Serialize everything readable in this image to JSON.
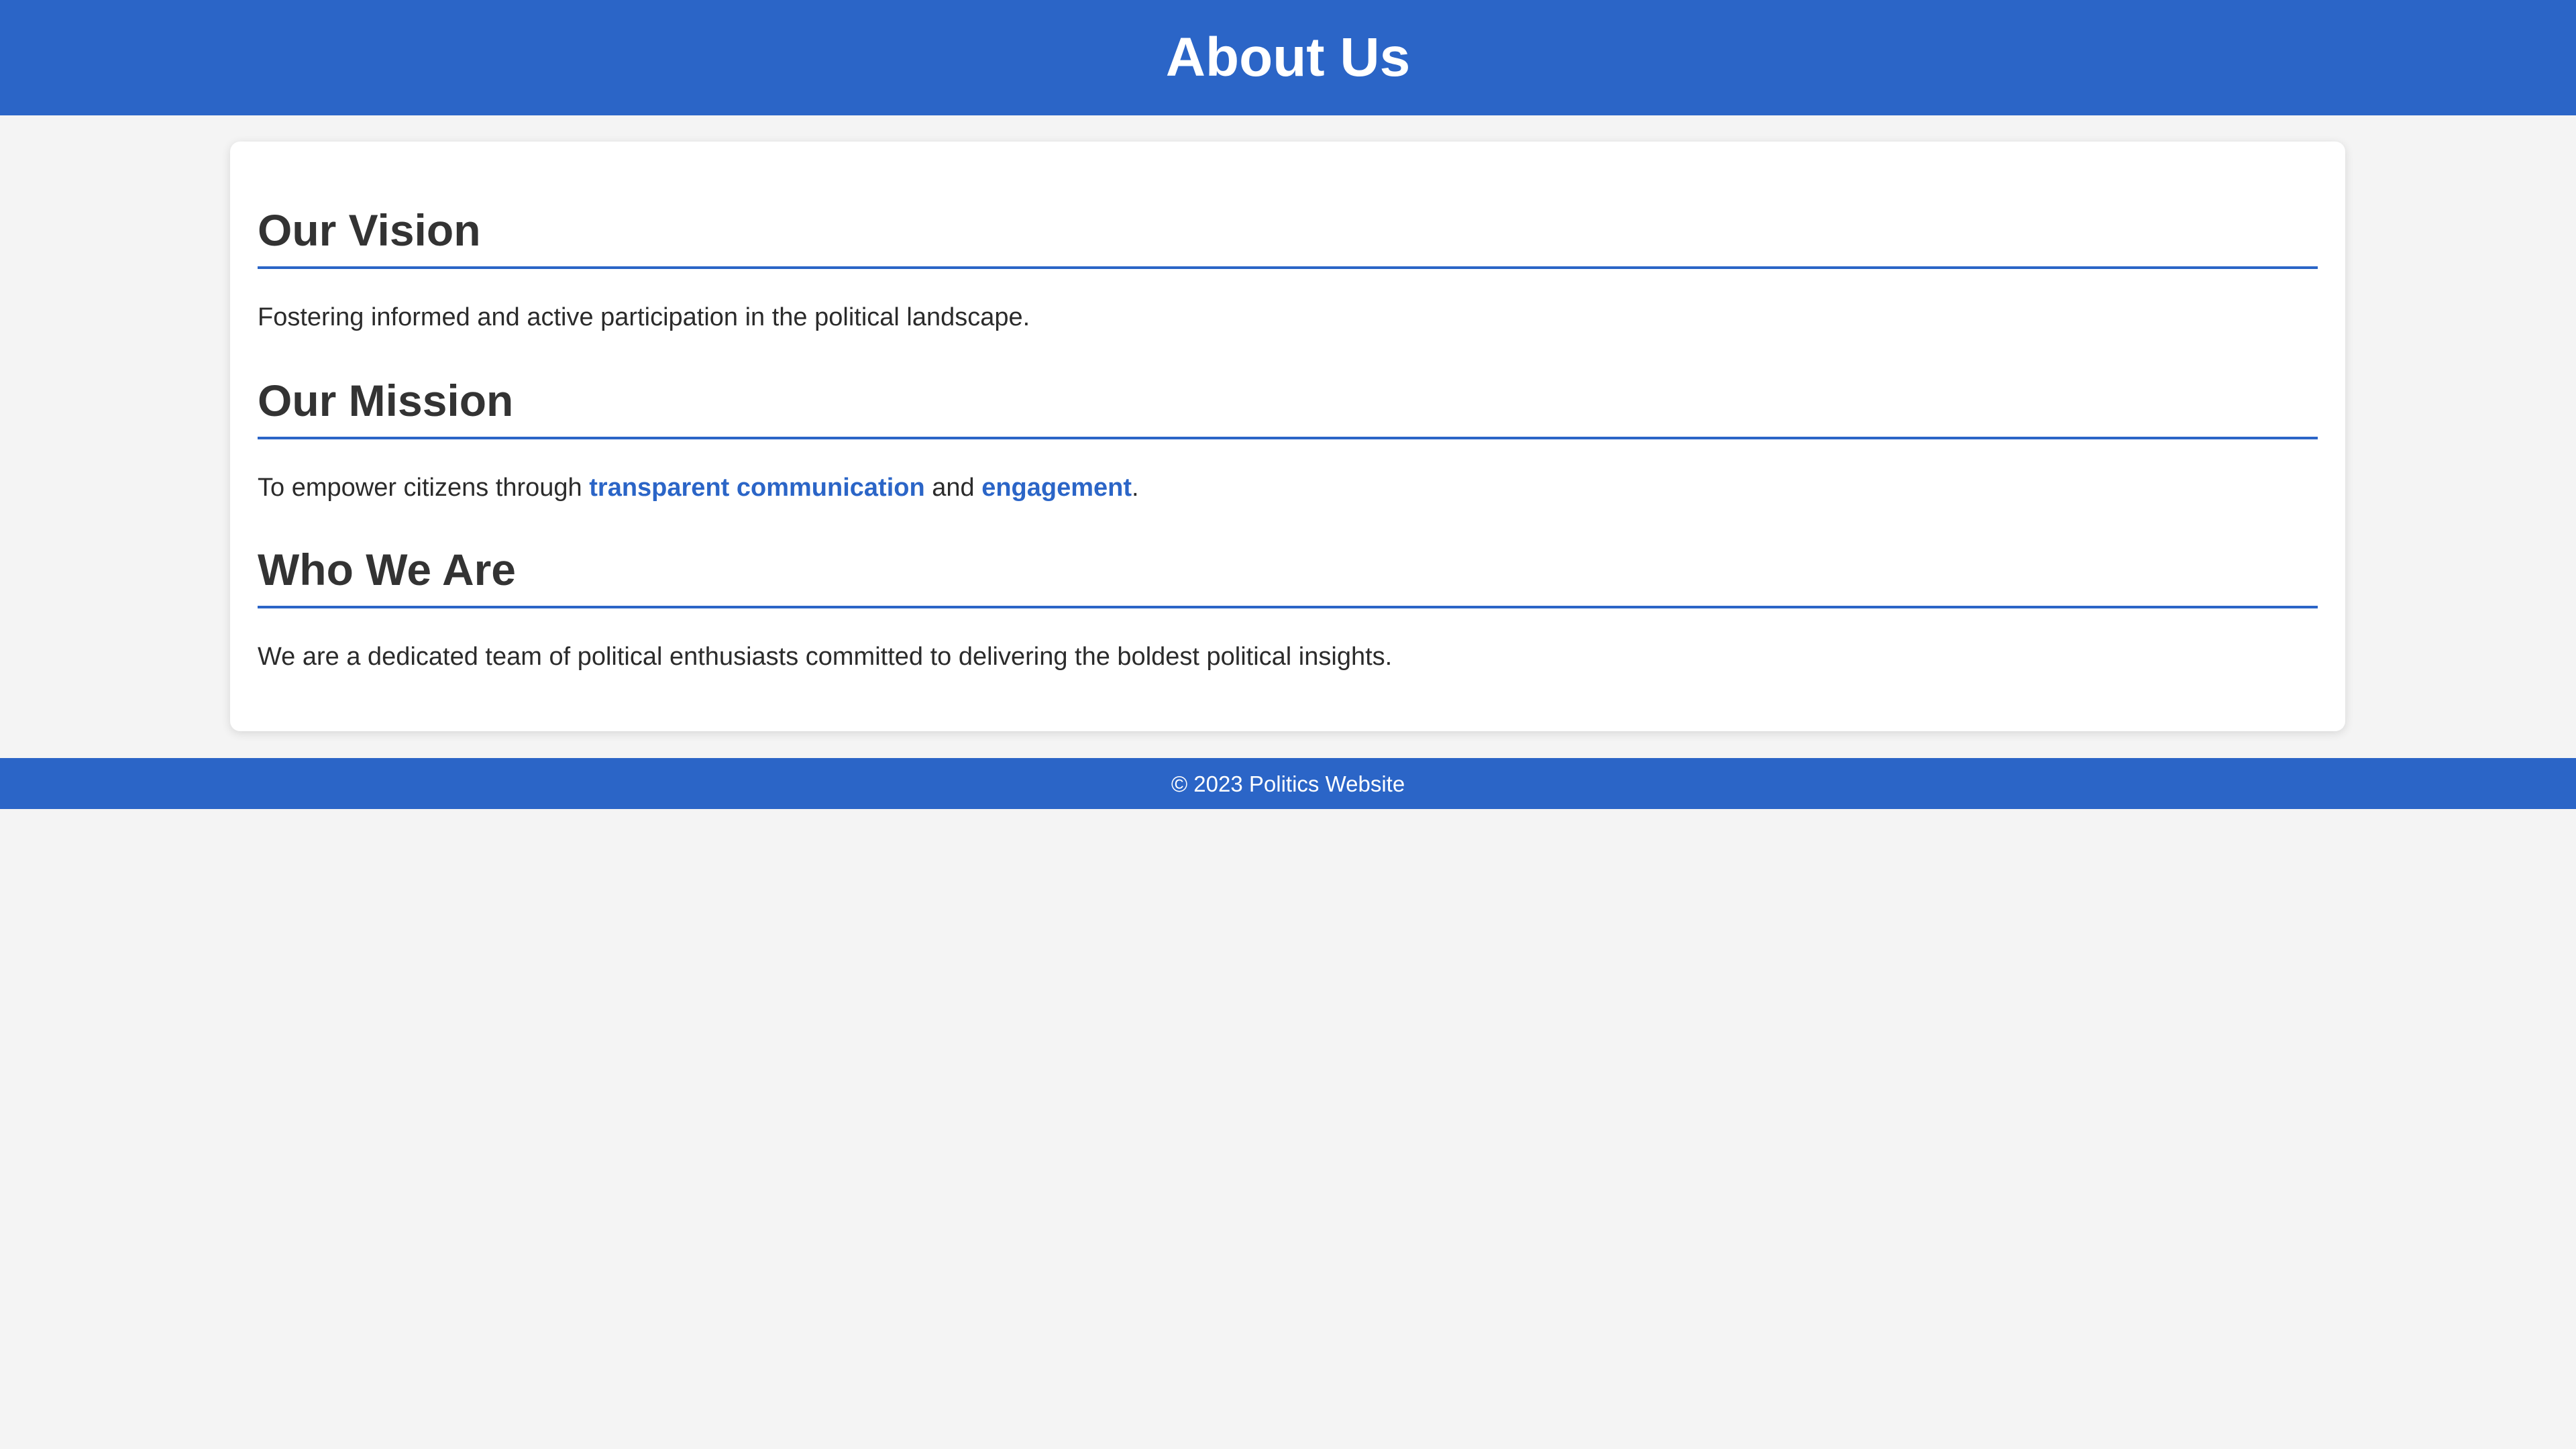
{
  "header": {
    "title": "About Us"
  },
  "sections": [
    {
      "title": "Our Vision",
      "text": "Fostering informed and active participation in the political landscape."
    },
    {
      "title": "Our Mission",
      "text_before": "To empower citizens through ",
      "link1": "transparent communication",
      "text_middle": " and ",
      "link2": "engagement",
      "text_after": "."
    },
    {
      "title": "Who We Are",
      "text": "We are a dedicated team of political enthusiasts committed to delivering the boldest political insights."
    }
  ],
  "footer": {
    "text": "© 2023 Politics Website"
  },
  "colors": {
    "brand": "#2b65c7",
    "background": "#f4f4f4",
    "card": "#ffffff",
    "text": "#333333"
  }
}
